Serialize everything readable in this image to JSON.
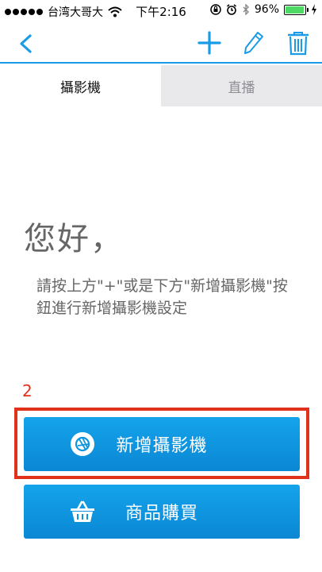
{
  "status_bar": {
    "carrier": "台湾大哥大",
    "time": "下午2:16",
    "battery": "96%",
    "battery_level": 0.96
  },
  "nav": {
    "back_icon": "chevron-left-icon",
    "actions": [
      "plus-icon",
      "pencil-icon",
      "trash-icon"
    ],
    "accent_color": "#1a9be6"
  },
  "tabs": [
    {
      "label": "攝影機",
      "active": true
    },
    {
      "label": "直播",
      "active": false
    }
  ],
  "content": {
    "greeting": "您好，",
    "instructions": "請按上方\"+\"或是下方\"新增攝影機\"按鈕進行新增攝影機設定"
  },
  "annotation": {
    "number": "2",
    "color": "#e0311b"
  },
  "buttons": {
    "add_camera": {
      "label": "新增攝影機",
      "icon": "camera-aperture-icon"
    },
    "purchase": {
      "label": "商品購買",
      "icon": "basket-icon"
    }
  }
}
